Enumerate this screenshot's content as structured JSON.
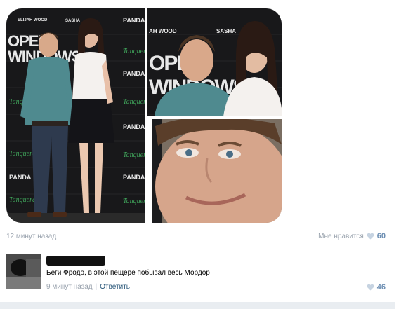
{
  "collage": {
    "left_photo": {
      "caption_names": [
        "ELIJAH WOOD",
        "SASHA"
      ],
      "brand_repeats": [
        "PANDA",
        "Tanqueray"
      ],
      "poster_text": "OPEN WINDOWS"
    },
    "top_right_photo": {
      "caption_names": [
        "AH WOOD",
        "SASHA"
      ]
    }
  },
  "post": {
    "timestamp": "12 минут назад",
    "like_label": "Мне нравится",
    "like_count": "60"
  },
  "comment": {
    "text": "Беги Фродо, в этой пещере побывал весь Мордор",
    "timestamp": "9 минут назад",
    "reply_label": "Ответить",
    "like_count": "46"
  },
  "colors": {
    "accent_link": "#2b587a",
    "meta_gray": "#9aa3ae",
    "like_blue": "#6d8fb3",
    "heart": "#c6d3e1"
  }
}
